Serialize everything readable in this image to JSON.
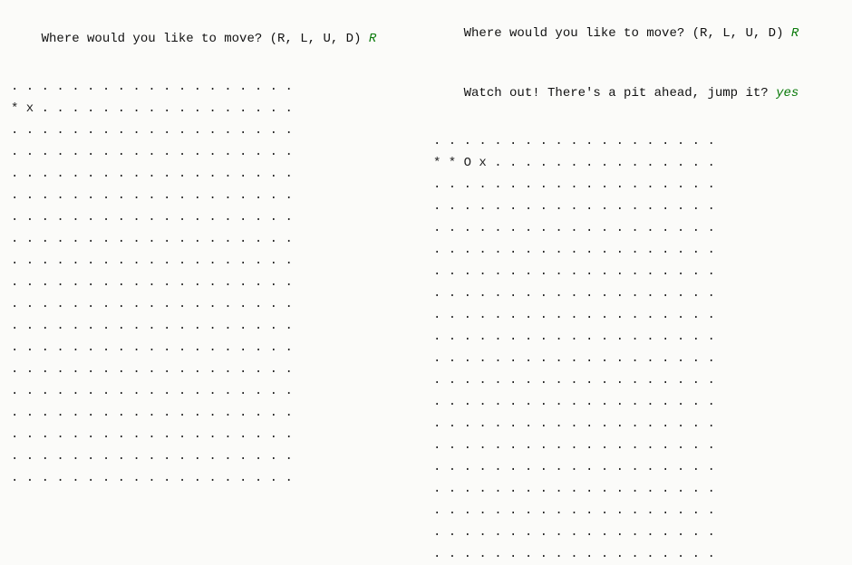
{
  "left": {
    "prompts": [
      {
        "question": "Where would you like to move? (R, L, U, D) ",
        "answer": "R"
      }
    ],
    "grid": {
      "cols": 19,
      "rows": 19,
      "special_row_index": 1,
      "special_cells": [
        "*",
        "x"
      ]
    }
  },
  "right": {
    "prompts": [
      {
        "question": "Where would you like to move? (R, L, U, D) ",
        "answer": "R"
      },
      {
        "question": "Watch out! There's a pit ahead, jump it? ",
        "answer": "yes"
      }
    ],
    "grid": {
      "cols": 19,
      "rows": 20,
      "special_row_index": 1,
      "special_cells": [
        "*",
        "*",
        "O",
        "x"
      ]
    }
  },
  "dot": "."
}
